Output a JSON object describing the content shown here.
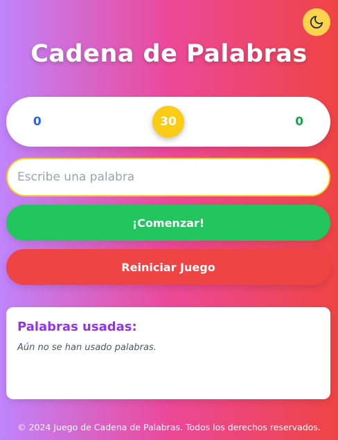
{
  "header": {
    "title": "Cadena de Palabras",
    "theme_toggle_icon": "moon-icon"
  },
  "scoreboard": {
    "player1": {
      "icon": "🐱",
      "score": "0",
      "color": "#2563eb"
    },
    "player2": {
      "icon": "🐱",
      "score": "0",
      "color": "#16a34a"
    },
    "timer": "30"
  },
  "input": {
    "placeholder": "Escribe una palabra",
    "value": ""
  },
  "buttons": {
    "start_label": "¡Comenzar!",
    "reset_label": "Reiniciar Juego"
  },
  "used_words": {
    "title": "Palabras usadas:",
    "empty_text": "Aún no se han usado palabras.",
    "items": []
  },
  "footer": {
    "text": "© 2024 Juego de Cadena de Palabras. Todos los derechos reservados."
  },
  "colors": {
    "gradient_start": "#c084fc",
    "gradient_mid": "#ec4899",
    "gradient_end": "#ef4444",
    "start_button": "#22c55e",
    "reset_button": "#ef4444",
    "timer": "#facc15",
    "theme_toggle": "#fcd34d",
    "panel_title": "#9333ea"
  }
}
